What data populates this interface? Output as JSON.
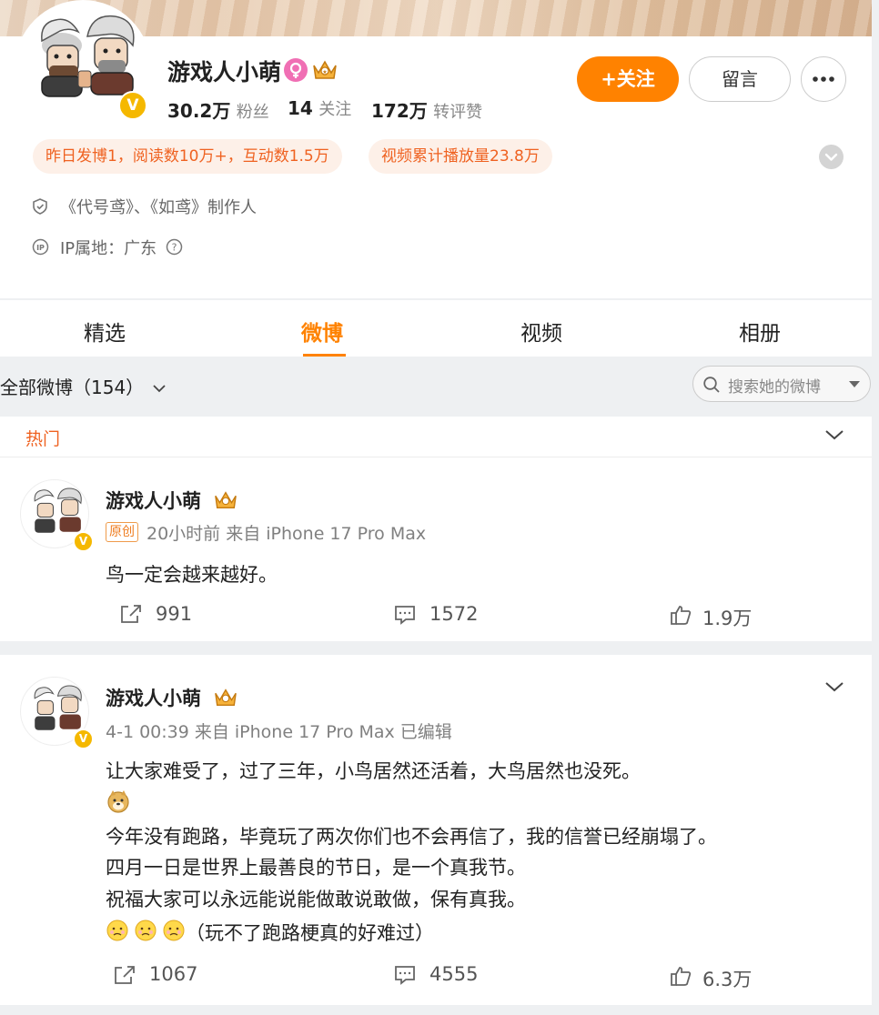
{
  "profile": {
    "name": "游戏人小萌",
    "stats": [
      {
        "value": "30.2万",
        "label": "粉丝"
      },
      {
        "value": "14",
        "label": "关注"
      },
      {
        "value": "172万",
        "label": "转评赞"
      }
    ],
    "follow_label": "+关注",
    "message_label": "留言",
    "highlights": [
      "昨日发博1，阅读数10万+，互动数1.5万",
      "视频累计播放量23.8万"
    ],
    "info": [
      {
        "icon": "shield-icon",
        "text": "《代号鸢》、《如鸢》制作人"
      },
      {
        "icon": "ip-icon",
        "text": "IP属地：广东"
      }
    ]
  },
  "tabs": [
    "精选",
    "微博",
    "视频",
    "相册"
  ],
  "active_tab": 1,
  "filter": {
    "label": "全部微博（154）"
  },
  "search": {
    "placeholder": "搜索她的微博"
  },
  "hot_section": {
    "label": "热门"
  },
  "posts": [
    {
      "author": "游戏人小萌",
      "original_tag": "原创",
      "meta": "20小时前 来自 iPhone 17 Pro Max",
      "lines": [
        "鸟一定会越来越好。"
      ],
      "reposts": "991",
      "comments": "1572",
      "likes": "1.9万"
    },
    {
      "author": "游戏人小萌",
      "meta": "4-1 00:39 来自 iPhone 17 Pro Max 已编辑",
      "lines": [
        "让大家难受了，过了三年，小鸟居然还活着，大鸟居然也没死。",
        "",
        "今年没有跑路，毕竟玩了两次你们也不会再信了，我的信誉已经崩塌了。",
        "四月一日是世界上最善良的节日，是一个真我节。",
        "祝福大家可以永远能说能做敢说敢做，保有真我。",
        "（玩不了跑路梗真的好难过）"
      ],
      "emoji_doge": "doge-emoji",
      "emoji_sad": "sad-emoji",
      "reposts": "1067",
      "comments": "4555",
      "likes": "6.3万"
    }
  ],
  "colors": {
    "accent": "#ff8200",
    "highlight_text": "#ef6221",
    "hot_label": "#ef6221",
    "verified": "#f5b800"
  }
}
